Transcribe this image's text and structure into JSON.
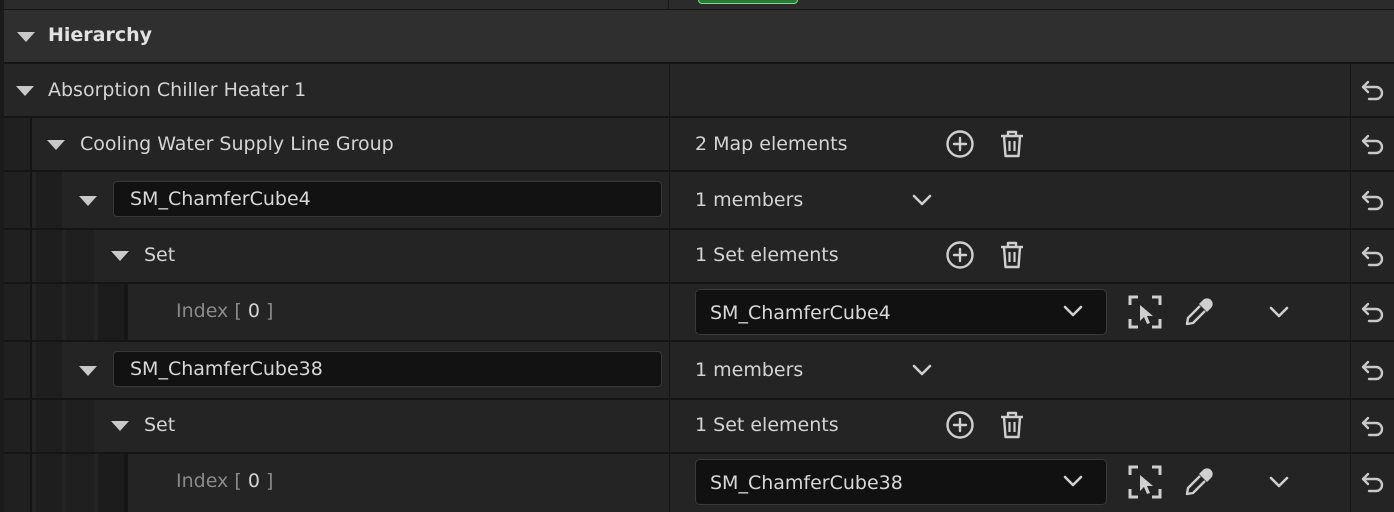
{
  "section": {
    "title": "Hierarchy"
  },
  "rows": {
    "chiller": {
      "label": "Absorption Chiller Heater 1"
    },
    "group": {
      "label": "Cooling Water Supply Line Group",
      "value": "2 Map elements"
    },
    "entry1": {
      "key": "SM_ChamferCube4",
      "members": "1 members",
      "set_label": "Set",
      "set_value": "1 Set elements",
      "index_label": "Index",
      "index_open": "[",
      "index_num": "0",
      "index_close": "]",
      "asset": "SM_ChamferCube4"
    },
    "entry2": {
      "key": "SM_ChamferCube38",
      "members": "1 members",
      "set_label": "Set",
      "set_value": "1 Set elements",
      "index_label": "Index",
      "index_open": "[",
      "index_num": "0",
      "index_close": "]",
      "asset": "SM_ChamferCube38"
    }
  },
  "colors": {
    "panel": "#242424",
    "header": "#2f2f2f",
    "field": "#121212",
    "text": "#d4d4d4",
    "dim_text": "#8a8a8a",
    "accent_green": "#2a7a36"
  },
  "icons": [
    "collapse-arrow-icon",
    "add-element-icon",
    "trash-icon",
    "chevron-down-icon",
    "select-asset-icon",
    "eyedropper-icon",
    "reset-arrow-icon"
  ]
}
